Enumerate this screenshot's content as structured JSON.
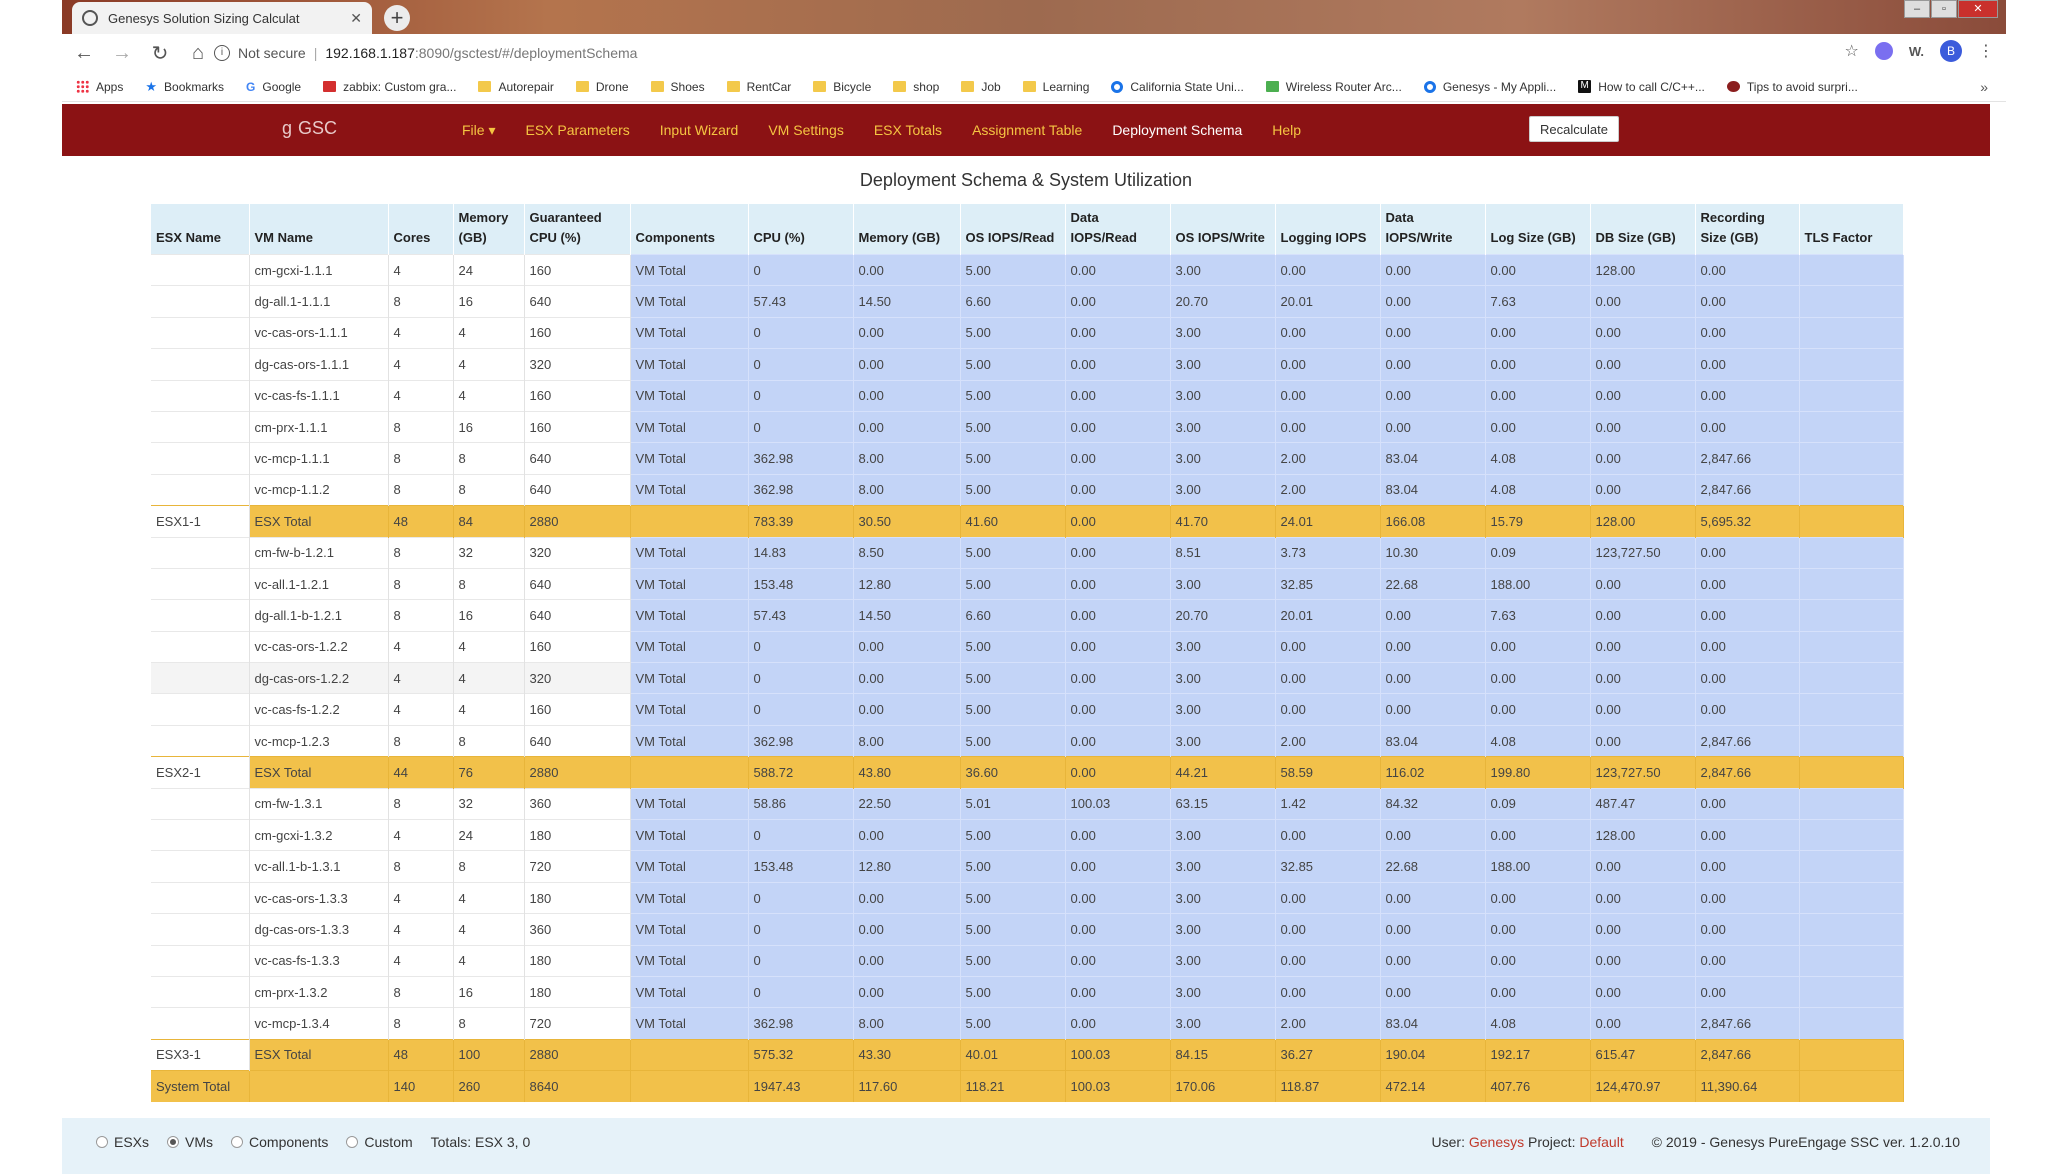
{
  "browser": {
    "tab_title": "Genesys Solution Sizing Calculat",
    "security_label": "Not secure",
    "url_host": "192.168.1.187",
    "url_path": ":8090/gsctest/#/deploymentSchema",
    "new_tab": "+",
    "bookmarks": [
      {
        "label": "Apps",
        "icon": "grid"
      },
      {
        "label": "Bookmarks",
        "icon": "star"
      },
      {
        "label": "Google",
        "icon": "g"
      },
      {
        "label": "zabbix: Custom gra...",
        "icon": "z"
      },
      {
        "label": "Autorepair",
        "icon": "folder"
      },
      {
        "label": "Drone",
        "icon": "folder"
      },
      {
        "label": "Shoes",
        "icon": "folder"
      },
      {
        "label": "RentCar",
        "icon": "folder"
      },
      {
        "label": "Bicycle",
        "icon": "folder"
      },
      {
        "label": "shop",
        "icon": "folder"
      },
      {
        "label": "Job",
        "icon": "folder"
      },
      {
        "label": "Learning",
        "icon": "folder"
      },
      {
        "label": "California State Uni...",
        "icon": "circ"
      },
      {
        "label": "Wireless Router Arc...",
        "icon": "wr"
      },
      {
        "label": "Genesys - My Appli...",
        "icon": "circ"
      },
      {
        "label": "How to call C/C++...",
        "icon": "m"
      },
      {
        "label": "Tips to avoid surpri...",
        "icon": "tip"
      }
    ],
    "more": "»",
    "avatar_letter": "B",
    "ext_label": "W."
  },
  "app": {
    "logo": "GSC",
    "menu": [
      {
        "label": "File ▾",
        "active": false
      },
      {
        "label": "ESX Parameters",
        "active": false
      },
      {
        "label": "Input Wizard",
        "active": false
      },
      {
        "label": "VM Settings",
        "active": false
      },
      {
        "label": "ESX Totals",
        "active": false
      },
      {
        "label": "Assignment Table",
        "active": false
      },
      {
        "label": "Deployment Schema",
        "active": true
      },
      {
        "label": "Help",
        "active": false
      }
    ],
    "recalculate": "Recalculate",
    "page_title": "Deployment Schema & System Utilization"
  },
  "table": {
    "headers": [
      "ESX Name",
      "VM Name",
      "Cores",
      "Memory (GB)",
      "Guaranteed CPU (%)",
      "Components",
      "CPU (%)",
      "Memory (GB)",
      "OS IOPS/Read",
      "Data IOPS/Read",
      "OS IOPS/Write",
      "Logging IOPS",
      "Data IOPS/Write",
      "Log Size (GB)",
      "DB Size (GB)",
      "Recording Size (GB)",
      "TLS Factor"
    ],
    "rows": [
      {
        "type": "vm",
        "cells": [
          "",
          "cm-gcxi-1.1.1",
          "4",
          "24",
          "160",
          "VM Total",
          "0",
          "0.00",
          "5.00",
          "0.00",
          "3.00",
          "0.00",
          "0.00",
          "0.00",
          "128.00",
          "0.00",
          ""
        ]
      },
      {
        "type": "vm",
        "cells": [
          "",
          "dg-all.1-1.1.1",
          "8",
          "16",
          "640",
          "VM Total",
          "57.43",
          "14.50",
          "6.60",
          "0.00",
          "20.70",
          "20.01",
          "0.00",
          "7.63",
          "0.00",
          "0.00",
          ""
        ]
      },
      {
        "type": "vm",
        "cells": [
          "",
          "vc-cas-ors-1.1.1",
          "4",
          "4",
          "160",
          "VM Total",
          "0",
          "0.00",
          "5.00",
          "0.00",
          "3.00",
          "0.00",
          "0.00",
          "0.00",
          "0.00",
          "0.00",
          ""
        ]
      },
      {
        "type": "vm",
        "cells": [
          "",
          "dg-cas-ors-1.1.1",
          "4",
          "4",
          "320",
          "VM Total",
          "0",
          "0.00",
          "5.00",
          "0.00",
          "3.00",
          "0.00",
          "0.00",
          "0.00",
          "0.00",
          "0.00",
          ""
        ]
      },
      {
        "type": "vm",
        "cells": [
          "",
          "vc-cas-fs-1.1.1",
          "4",
          "4",
          "160",
          "VM Total",
          "0",
          "0.00",
          "5.00",
          "0.00",
          "3.00",
          "0.00",
          "0.00",
          "0.00",
          "0.00",
          "0.00",
          ""
        ]
      },
      {
        "type": "vm",
        "cells": [
          "",
          "cm-prx-1.1.1",
          "8",
          "16",
          "160",
          "VM Total",
          "0",
          "0.00",
          "5.00",
          "0.00",
          "3.00",
          "0.00",
          "0.00",
          "0.00",
          "0.00",
          "0.00",
          ""
        ]
      },
      {
        "type": "vm",
        "cells": [
          "",
          "vc-mcp-1.1.1",
          "8",
          "8",
          "640",
          "VM Total",
          "362.98",
          "8.00",
          "5.00",
          "0.00",
          "3.00",
          "2.00",
          "83.04",
          "4.08",
          "0.00",
          "2,847.66",
          ""
        ]
      },
      {
        "type": "vm",
        "cells": [
          "",
          "vc-mcp-1.1.2",
          "8",
          "8",
          "640",
          "VM Total",
          "362.98",
          "8.00",
          "5.00",
          "0.00",
          "3.00",
          "2.00",
          "83.04",
          "4.08",
          "0.00",
          "2,847.66",
          ""
        ]
      },
      {
        "type": "esx",
        "cells": [
          "ESX1-1",
          "ESX Total",
          "48",
          "84",
          "2880",
          "",
          "783.39",
          "30.50",
          "41.60",
          "0.00",
          "41.70",
          "24.01",
          "166.08",
          "15.79",
          "128.00",
          "5,695.32",
          ""
        ]
      },
      {
        "type": "vm",
        "cells": [
          "",
          "cm-fw-b-1.2.1",
          "8",
          "32",
          "320",
          "VM Total",
          "14.83",
          "8.50",
          "5.00",
          "0.00",
          "8.51",
          "3.73",
          "10.30",
          "0.09",
          "123,727.50",
          "0.00",
          ""
        ]
      },
      {
        "type": "vm",
        "cells": [
          "",
          "vc-all.1-1.2.1",
          "8",
          "8",
          "640",
          "VM Total",
          "153.48",
          "12.80",
          "5.00",
          "0.00",
          "3.00",
          "32.85",
          "22.68",
          "188.00",
          "0.00",
          "0.00",
          ""
        ]
      },
      {
        "type": "vm",
        "cells": [
          "",
          "dg-all.1-b-1.2.1",
          "8",
          "16",
          "640",
          "VM Total",
          "57.43",
          "14.50",
          "6.60",
          "0.00",
          "20.70",
          "20.01",
          "0.00",
          "7.63",
          "0.00",
          "0.00",
          ""
        ]
      },
      {
        "type": "vm",
        "cells": [
          "",
          "vc-cas-ors-1.2.2",
          "4",
          "4",
          "160",
          "VM Total",
          "0",
          "0.00",
          "5.00",
          "0.00",
          "3.00",
          "0.00",
          "0.00",
          "0.00",
          "0.00",
          "0.00",
          ""
        ]
      },
      {
        "type": "vm alt",
        "cells": [
          "",
          "dg-cas-ors-1.2.2",
          "4",
          "4",
          "320",
          "VM Total",
          "0",
          "0.00",
          "5.00",
          "0.00",
          "3.00",
          "0.00",
          "0.00",
          "0.00",
          "0.00",
          "0.00",
          ""
        ]
      },
      {
        "type": "vm",
        "cells": [
          "",
          "vc-cas-fs-1.2.2",
          "4",
          "4",
          "160",
          "VM Total",
          "0",
          "0.00",
          "5.00",
          "0.00",
          "3.00",
          "0.00",
          "0.00",
          "0.00",
          "0.00",
          "0.00",
          ""
        ]
      },
      {
        "type": "vm",
        "cells": [
          "",
          "vc-mcp-1.2.3",
          "8",
          "8",
          "640",
          "VM Total",
          "362.98",
          "8.00",
          "5.00",
          "0.00",
          "3.00",
          "2.00",
          "83.04",
          "4.08",
          "0.00",
          "2,847.66",
          ""
        ]
      },
      {
        "type": "esx",
        "cells": [
          "ESX2-1",
          "ESX Total",
          "44",
          "76",
          "2880",
          "",
          "588.72",
          "43.80",
          "36.60",
          "0.00",
          "44.21",
          "58.59",
          "116.02",
          "199.80",
          "123,727.50",
          "2,847.66",
          ""
        ]
      },
      {
        "type": "vm",
        "cells": [
          "",
          "cm-fw-1.3.1",
          "8",
          "32",
          "360",
          "VM Total",
          "58.86",
          "22.50",
          "5.01",
          "100.03",
          "63.15",
          "1.42",
          "84.32",
          "0.09",
          "487.47",
          "0.00",
          ""
        ]
      },
      {
        "type": "vm",
        "cells": [
          "",
          "cm-gcxi-1.3.2",
          "4",
          "24",
          "180",
          "VM Total",
          "0",
          "0.00",
          "5.00",
          "0.00",
          "3.00",
          "0.00",
          "0.00",
          "0.00",
          "128.00",
          "0.00",
          ""
        ]
      },
      {
        "type": "vm",
        "cells": [
          "",
          "vc-all.1-b-1.3.1",
          "8",
          "8",
          "720",
          "VM Total",
          "153.48",
          "12.80",
          "5.00",
          "0.00",
          "3.00",
          "32.85",
          "22.68",
          "188.00",
          "0.00",
          "0.00",
          ""
        ]
      },
      {
        "type": "vm",
        "cells": [
          "",
          "vc-cas-ors-1.3.3",
          "4",
          "4",
          "180",
          "VM Total",
          "0",
          "0.00",
          "5.00",
          "0.00",
          "3.00",
          "0.00",
          "0.00",
          "0.00",
          "0.00",
          "0.00",
          ""
        ]
      },
      {
        "type": "vm",
        "cells": [
          "",
          "dg-cas-ors-1.3.3",
          "4",
          "4",
          "360",
          "VM Total",
          "0",
          "0.00",
          "5.00",
          "0.00",
          "3.00",
          "0.00",
          "0.00",
          "0.00",
          "0.00",
          "0.00",
          ""
        ]
      },
      {
        "type": "vm",
        "cells": [
          "",
          "vc-cas-fs-1.3.3",
          "4",
          "4",
          "180",
          "VM Total",
          "0",
          "0.00",
          "5.00",
          "0.00",
          "3.00",
          "0.00",
          "0.00",
          "0.00",
          "0.00",
          "0.00",
          ""
        ]
      },
      {
        "type": "vm",
        "cells": [
          "",
          "cm-prx-1.3.2",
          "8",
          "16",
          "180",
          "VM Total",
          "0",
          "0.00",
          "5.00",
          "0.00",
          "3.00",
          "0.00",
          "0.00",
          "0.00",
          "0.00",
          "0.00",
          ""
        ]
      },
      {
        "type": "vm",
        "cells": [
          "",
          "vc-mcp-1.3.4",
          "8",
          "8",
          "720",
          "VM Total",
          "362.98",
          "8.00",
          "5.00",
          "0.00",
          "3.00",
          "2.00",
          "83.04",
          "4.08",
          "0.00",
          "2,847.66",
          ""
        ]
      },
      {
        "type": "esx",
        "cells": [
          "ESX3-1",
          "ESX Total",
          "48",
          "100",
          "2880",
          "",
          "575.32",
          "43.30",
          "40.01",
          "100.03",
          "84.15",
          "36.27",
          "190.04",
          "192.17",
          "615.47",
          "2,847.66",
          ""
        ]
      },
      {
        "type": "sys",
        "cells": [
          "System Total",
          "",
          "140",
          "260",
          "8640",
          "",
          "1947.43",
          "117.60",
          "118.21",
          "100.03",
          "170.06",
          "118.87",
          "472.14",
          "407.76",
          "124,470.97",
          "11,390.64",
          ""
        ]
      }
    ]
  },
  "footer": {
    "view_options": [
      {
        "label": "ESXs",
        "checked": false
      },
      {
        "label": "VMs",
        "checked": true
      },
      {
        "label": "Components",
        "checked": false
      },
      {
        "label": "Custom",
        "checked": false
      }
    ],
    "totals": "Totals: ESX 3, 0",
    "user_label": "User:",
    "user": "Genesys",
    "project_label": "Project:",
    "project": "Default",
    "copyright": "© 2019 - Genesys PureEngage SSC ver. 1.2.0.10"
  },
  "colors": {
    "navbar": "#8b1214",
    "menu_link": "#f5c542",
    "vm_cell": "#c3d4f7",
    "total_row": "#f2c14a",
    "header_bg": "#ddeef7"
  }
}
